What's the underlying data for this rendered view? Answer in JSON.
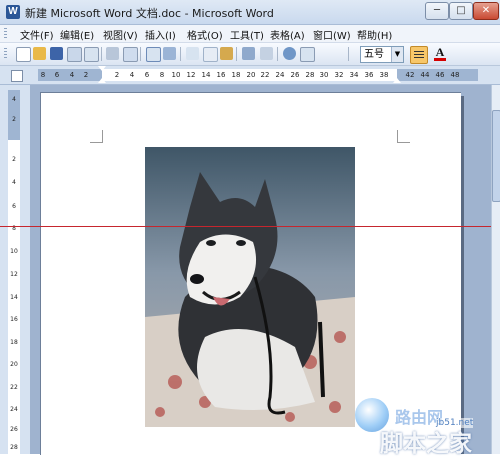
{
  "window": {
    "title": "新建 Microsoft Word 文档.doc - Microsoft Word",
    "app_icon": "W",
    "min_label": "─",
    "max_label": "□",
    "close_label": "✕"
  },
  "menu": {
    "items": [
      "文件(F)",
      "编辑(E)",
      "视图(V)",
      "插入(I)",
      "格式(O)",
      "工具(T)",
      "表格(A)",
      "窗口(W)",
      "帮助(H)"
    ]
  },
  "toolbar": {
    "font_size": "五号",
    "font_color_label": "A",
    "accent": "#f7c76a"
  },
  "ruler": {
    "h_ticks": [
      "8",
      "6",
      "4",
      "2",
      "2",
      "4",
      "6",
      "8",
      "10",
      "12",
      "14",
      "16",
      "18",
      "20",
      "22",
      "24",
      "26",
      "28",
      "30",
      "32",
      "34",
      "36",
      "38",
      "42",
      "44",
      "46",
      "48"
    ],
    "v_ticks": [
      "4",
      "2",
      "2",
      "4",
      "6",
      "8",
      "10",
      "12",
      "14",
      "16",
      "18",
      "20",
      "22",
      "24",
      "26",
      "28"
    ]
  },
  "document": {
    "image_subject": "husky-dog-photo",
    "guide_line_color": "#c6262e"
  },
  "watermark": {
    "top": "路由网",
    "bottom": "脚本之家",
    "url": "jb51.net"
  }
}
